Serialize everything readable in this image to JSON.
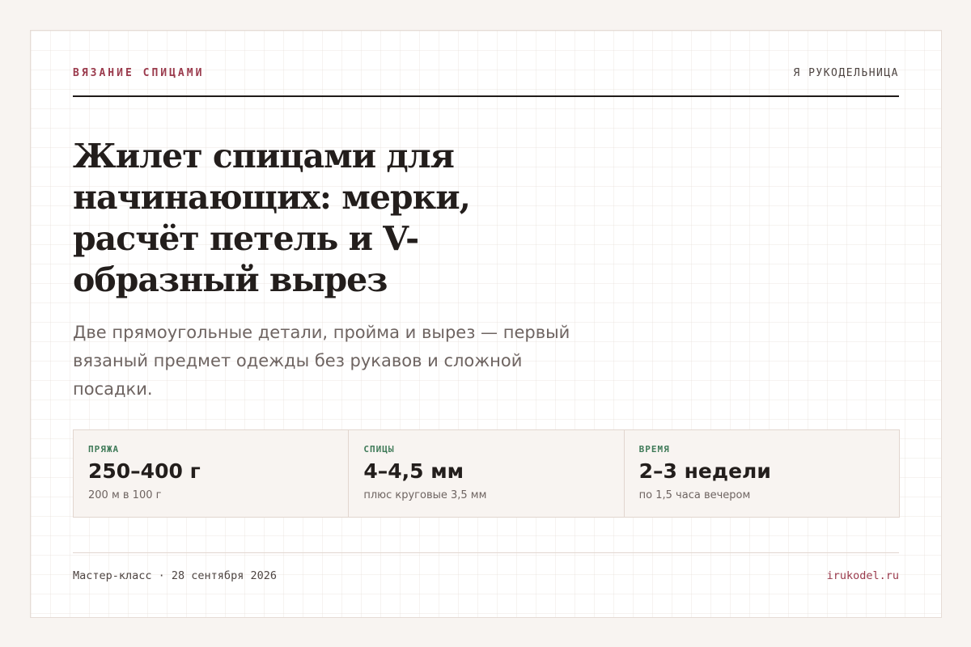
{
  "header": {
    "rubric": "ВЯЗАНИЕ СПИЦАМИ",
    "brand": "Я РУКОДЕЛЬНИЦА"
  },
  "article": {
    "title": "Жилет спицами для начинающих: мерки, расчёт петель и V-образный вырез",
    "lead": "Две прямоугольные детали, пройма и вырез — первый вязаный предмет одежды без рукавов и сложной посадки."
  },
  "specs": [
    {
      "label": "ПРЯЖА",
      "value": "250–400 г",
      "note": "200 м в 100 г"
    },
    {
      "label": "СПИЦЫ",
      "value": "4–4,5 мм",
      "note": "плюс круговые 3,5 мм"
    },
    {
      "label": "ВРЕМЯ",
      "value": "2–3 недели",
      "note": "по 1,5 часа вечером"
    }
  ],
  "footer": {
    "meta": "Мастер-класс · 28 сентября 2026",
    "site": "irukodel.ru"
  },
  "colors": {
    "accent": "#9a3a4c",
    "label_green": "#3f7a58",
    "text_dark": "#231e1c",
    "text_muted": "#6e6461",
    "page_background": "#f8f4f1"
  }
}
